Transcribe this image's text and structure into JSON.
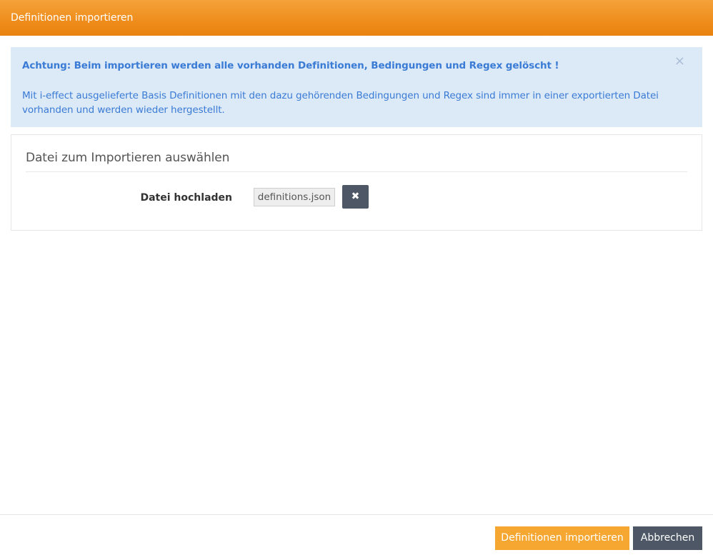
{
  "header": {
    "title": "Definitionen importieren"
  },
  "alert": {
    "title": "Achtung: Beim importieren werden alle vorhanden Definitionen, Bedingungen und Regex gelöscht !",
    "text": "Mit i-effect ausgelieferte Basis Definitionen mit den dazu gehörenden Bedingungen und Regex sind immer in einer exportierten Datei vorhanden und werden wieder hergestellt.",
    "close_glyph": "×",
    "close_icon": "close-icon"
  },
  "panel": {
    "title": "Datei zum Importieren auswählen",
    "field_label": "Datei hochladen",
    "file_name": "definitions.json",
    "remove_glyph": "✖",
    "remove_icon": "remove-icon"
  },
  "footer": {
    "import_label": "Definitionen importieren",
    "cancel_label": "Abbrechen"
  },
  "colors": {
    "header_orange": "#ef8d1c",
    "alert_bg": "#dce9f7",
    "alert_text": "#3a7bd5",
    "import_button": "#f5a731",
    "dark_button": "#4d5765"
  }
}
